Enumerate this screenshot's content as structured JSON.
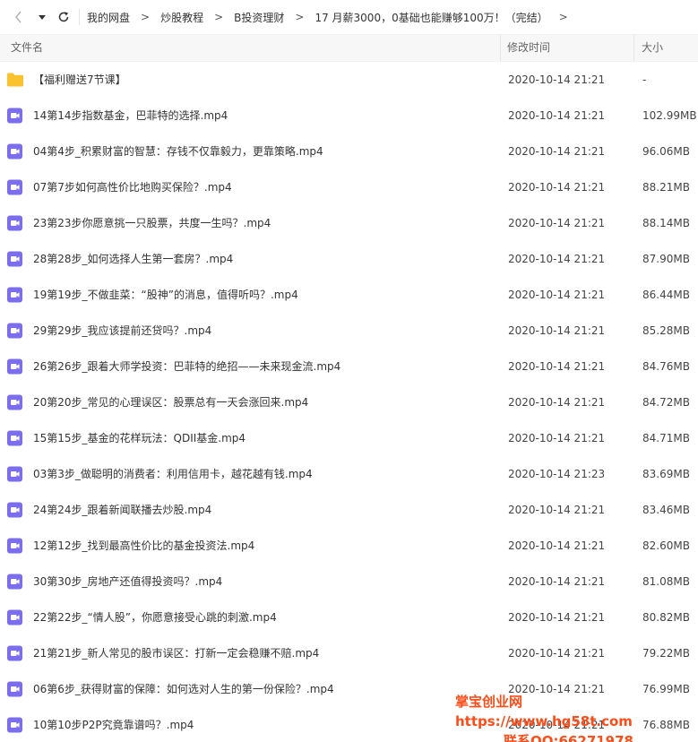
{
  "toolbar": {
    "back_icon": "chevron-left-icon",
    "dropdown_icon": "caret-down-icon",
    "refresh_icon": "refresh-icon"
  },
  "breadcrumb": {
    "items": [
      "我的网盘",
      "炒股教程",
      "B投资理财",
      "17 月薪3000，0基础也能赚够100万！（完结）"
    ],
    "separator": ">"
  },
  "columns": {
    "name": "文件名",
    "modified": "修改时间",
    "size": "大小"
  },
  "colors": {
    "folder": "#f9c22e",
    "video": "#7b6cf0",
    "watermark": "#ff4d1a"
  },
  "files": [
    {
      "type": "folder",
      "name": "【福利赠送7节课】",
      "modified": "2020-10-14 21:21",
      "size": "-"
    },
    {
      "type": "video",
      "name": "14第14步指数基金，巴菲特的选择.mp4",
      "modified": "2020-10-14 21:21",
      "size": "102.99MB"
    },
    {
      "type": "video",
      "name": "04第4步_积累财富的智慧：存钱不仅靠毅力，更靠策略.mp4",
      "modified": "2020-10-14 21:21",
      "size": "96.06MB"
    },
    {
      "type": "video",
      "name": "07第7步如何高性价比地购买保险？.mp4",
      "modified": "2020-10-14 21:21",
      "size": "88.21MB"
    },
    {
      "type": "video",
      "name": "23第23步你愿意挑一只股票，共度一生吗？.mp4",
      "modified": "2020-10-14 21:21",
      "size": "88.14MB"
    },
    {
      "type": "video",
      "name": "28第28步_如何选择人生第一套房？.mp4",
      "modified": "2020-10-14 21:21",
      "size": "87.90MB"
    },
    {
      "type": "video",
      "name": "19第19步_不做韭菜：“股神”的消息，值得听吗？.mp4",
      "modified": "2020-10-14 21:21",
      "size": "86.44MB"
    },
    {
      "type": "video",
      "name": "29第29步_我应该提前还贷吗？.mp4",
      "modified": "2020-10-14 21:21",
      "size": "85.28MB"
    },
    {
      "type": "video",
      "name": "26第26步_跟着大师学投资：巴菲特的绝招——未来现金流.mp4",
      "modified": "2020-10-14 21:21",
      "size": "84.76MB"
    },
    {
      "type": "video",
      "name": "20第20步_常见的心理误区：股票总有一天会涨回来.mp4",
      "modified": "2020-10-14 21:21",
      "size": "84.72MB"
    },
    {
      "type": "video",
      "name": "15第15步_基金的花样玩法：QDII基金.mp4",
      "modified": "2020-10-14 21:21",
      "size": "84.71MB"
    },
    {
      "type": "video",
      "name": "03第3步_做聪明的消费者：利用信用卡，越花越有钱.mp4",
      "modified": "2020-10-14 21:23",
      "size": "83.69MB"
    },
    {
      "type": "video",
      "name": "24第24步_跟着新闻联播去炒股.mp4",
      "modified": "2020-10-14 21:21",
      "size": "83.46MB"
    },
    {
      "type": "video",
      "name": "12第12步_找到最高性价比的基金投资法.mp4",
      "modified": "2020-10-14 21:21",
      "size": "82.60MB"
    },
    {
      "type": "video",
      "name": "30第30步_房地产还值得投资吗？.mp4",
      "modified": "2020-10-14 21:21",
      "size": "81.08MB"
    },
    {
      "type": "video",
      "name": "22第22步_“情人股”，你愿意接受心跳的刺激.mp4",
      "modified": "2020-10-14 21:21",
      "size": "80.82MB"
    },
    {
      "type": "video",
      "name": "21第21步_新人常见的股市误区：打新一定会稳赚不赔.mp4",
      "modified": "2020-10-14 21:21",
      "size": "79.22MB"
    },
    {
      "type": "video",
      "name": "06第6步_获得财富的保障：如何选对人生的第一份保险？.mp4",
      "modified": "2020-10-14 21:21",
      "size": "76.99MB"
    },
    {
      "type": "video",
      "name": "10第10步P2P究竟靠谱吗？.mp4",
      "modified": "2020-10-14 21:21",
      "size": "76.88MB"
    }
  ],
  "watermark": {
    "line1": "掌宝创业网https://www.hg58t.com",
    "line2": "联系QQ:66271978"
  }
}
